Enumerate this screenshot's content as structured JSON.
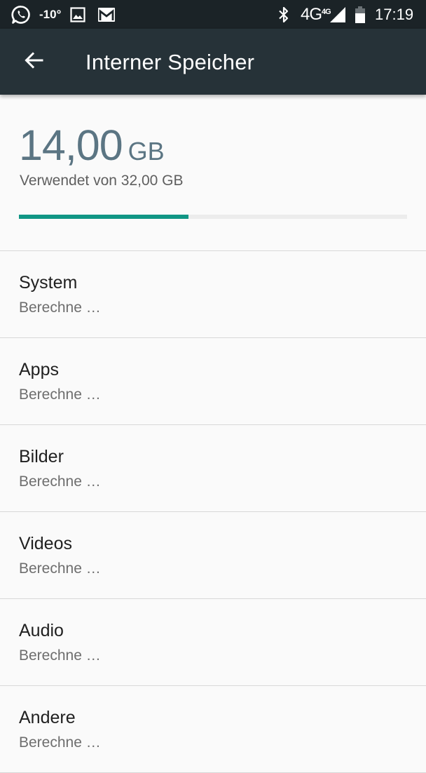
{
  "status_bar": {
    "temperature": "-10°",
    "network": "4G",
    "network_small": "4G",
    "time": "17:19",
    "icons": [
      "whatsapp-icon",
      "image-icon",
      "gmail-icon",
      "bluetooth-icon",
      "signal-icon",
      "battery-icon"
    ]
  },
  "app_bar": {
    "title": "Interner Speicher",
    "back_icon": "arrow-left-icon",
    "background": "#263238"
  },
  "storage": {
    "used_value": "14,00",
    "used_unit": "GB",
    "caption": "Verwendet von 32,00 GB",
    "used_fraction": 0.4375,
    "accent": "#109685"
  },
  "categories": [
    {
      "title": "System",
      "subtitle": "Berechne …"
    },
    {
      "title": "Apps",
      "subtitle": "Berechne …"
    },
    {
      "title": "Bilder",
      "subtitle": "Berechne …"
    },
    {
      "title": "Videos",
      "subtitle": "Berechne …"
    },
    {
      "title": "Audio",
      "subtitle": "Berechne …"
    },
    {
      "title": "Andere",
      "subtitle": "Berechne …"
    }
  ]
}
